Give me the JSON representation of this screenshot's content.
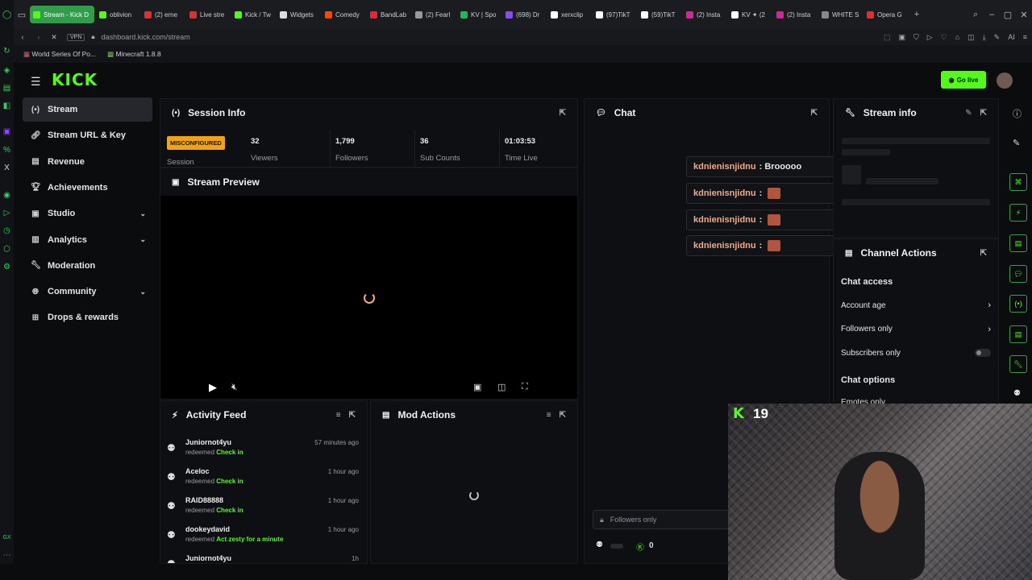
{
  "browser": {
    "tabs": [
      {
        "label": "Stream - Kick D",
        "active": true
      },
      {
        "label": "oblivion",
        "active": false
      },
      {
        "label": "(2) erne",
        "active": false
      },
      {
        "label": "Live stre",
        "active": false
      },
      {
        "label": "Kick / Tw",
        "active": false
      },
      {
        "label": "Widgets",
        "active": false
      },
      {
        "label": "Comedy",
        "active": false
      },
      {
        "label": "BandLab",
        "active": false
      },
      {
        "label": "(2) Fearl",
        "active": false
      },
      {
        "label": "KV | Spo",
        "active": false
      },
      {
        "label": "(698) Dr",
        "active": false
      },
      {
        "label": "xerxclip",
        "active": false
      },
      {
        "label": "(97)TikT",
        "active": false
      },
      {
        "label": "(59)TikT",
        "active": false
      },
      {
        "label": "(2) Insta",
        "active": false
      },
      {
        "label": "KV ✦ (2",
        "active": false
      },
      {
        "label": "(2) Insta",
        "active": false
      },
      {
        "label": "WHITE S",
        "active": false
      },
      {
        "label": "Opera G",
        "active": false
      }
    ],
    "vpn_label": "VPN",
    "url": "dashboard.kick.com/stream",
    "bookmarks": [
      "World Series Of Po...",
      "Minecraft 1.8.8"
    ]
  },
  "app": {
    "logo": "KICK",
    "go_live_label": "Go live"
  },
  "sidebar": {
    "items": [
      {
        "label": "Stream",
        "icon": "broadcast-icon",
        "active": true,
        "chevron": false
      },
      {
        "label": "Stream URL & Key",
        "icon": "link-icon",
        "active": false,
        "chevron": false
      },
      {
        "label": "Revenue",
        "icon": "revenue-icon",
        "active": false,
        "chevron": false
      },
      {
        "label": "Achievements",
        "icon": "trophy-icon",
        "active": false,
        "chevron": false
      },
      {
        "label": "Studio",
        "icon": "studio-icon",
        "active": false,
        "chevron": true
      },
      {
        "label": "Analytics",
        "icon": "chart-icon",
        "active": false,
        "chevron": true
      },
      {
        "label": "Moderation",
        "icon": "wrench-icon",
        "active": false,
        "chevron": false
      },
      {
        "label": "Community",
        "icon": "globe-icon",
        "active": false,
        "chevron": true
      },
      {
        "label": "Drops & rewards",
        "icon": "gift-icon",
        "active": false,
        "chevron": false
      }
    ]
  },
  "session": {
    "title": "Session Info",
    "status_badge": "MISCONFIGURED",
    "status_label": "Session",
    "stats": [
      {
        "value": "32",
        "label": "Viewers"
      },
      {
        "value": "1,799",
        "label": "Followers"
      },
      {
        "value": "36",
        "label": "Sub Counts"
      },
      {
        "value": "01:03:53",
        "label": "Time Live"
      }
    ]
  },
  "preview": {
    "title": "Stream Preview"
  },
  "activity": {
    "title": "Activity Feed",
    "items": [
      {
        "name": "Juniornot4yu",
        "action": "redeemed",
        "reward": "Check in",
        "time": "57 minutes ago"
      },
      {
        "name": "Aceloc",
        "action": "redeemed",
        "reward": "Check in",
        "time": "1 hour ago"
      },
      {
        "name": "RAID88888",
        "action": "redeemed",
        "reward": "Check in",
        "time": "1 hour ago"
      },
      {
        "name": "dookeydavid",
        "action": "redeemed",
        "reward": "Act zesty for a minute",
        "time": "1 hour ago"
      },
      {
        "name": "Juniornot4yu",
        "action": "",
        "reward": "",
        "time": "1h"
      }
    ]
  },
  "mod_actions": {
    "title": "Mod Actions"
  },
  "chat": {
    "title": "Chat",
    "messages": [
      {
        "user": "kdnienisnjidnu",
        "sep": ":",
        "text": "Brooooo",
        "emote": false
      },
      {
        "user": "kdnienisnjidnu",
        "sep": ":",
        "text": "",
        "emote": true
      },
      {
        "user": "kdnienisnjidnu",
        "sep": ":",
        "text": "",
        "emote": true
      },
      {
        "user": "kdnienisnjidnu",
        "sep": ":",
        "text": "",
        "emote": true
      }
    ],
    "input_placeholder": "Followers only",
    "counter": "0"
  },
  "stream_info": {
    "title": "Stream info"
  },
  "channel_actions": {
    "title": "Channel Actions",
    "chat_access_heading": "Chat access",
    "rows": [
      {
        "label": "Account age",
        "type": "chevron"
      },
      {
        "label": "Followers only",
        "type": "chevron"
      },
      {
        "label": "Subscribers only",
        "type": "toggle"
      }
    ],
    "chat_options_heading": "Chat options",
    "partial_row": "Emotes only"
  },
  "webcam": {
    "overlay_count": "19",
    "overlay_logo": "K"
  },
  "colors": {
    "accent": "#53fc18",
    "badge": "#f2a30f",
    "username": "#f2a984"
  }
}
